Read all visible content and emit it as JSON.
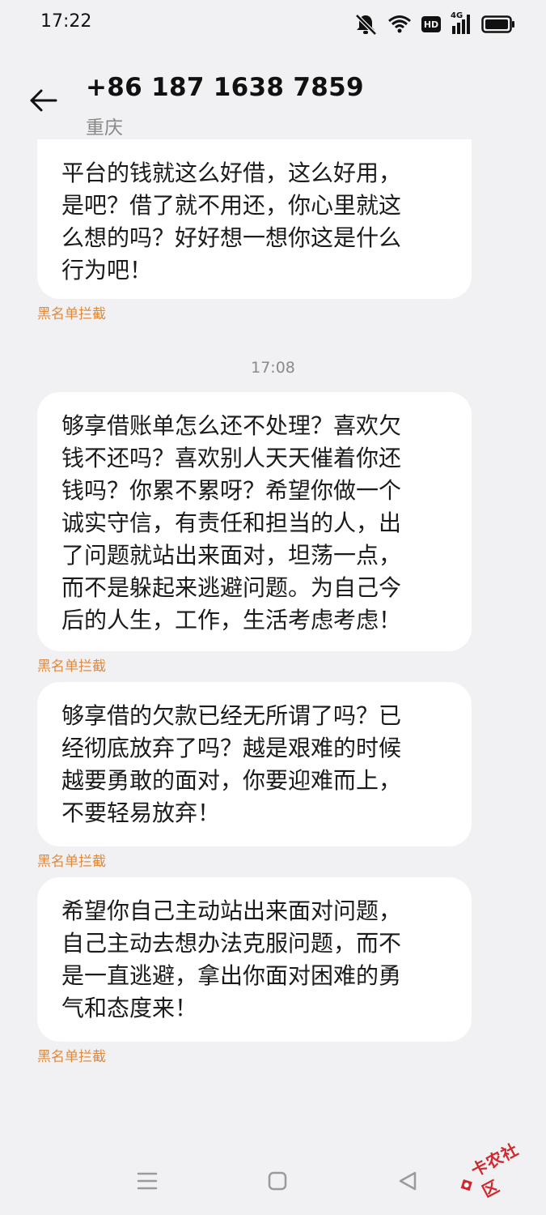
{
  "status_bar": {
    "time": "17:22",
    "icons": [
      "mute-icon",
      "wifi-icon",
      "hd-icon",
      "signal-4g-icon",
      "battery-icon"
    ],
    "hd_label": "HD",
    "network_label": "4G"
  },
  "header": {
    "back_icon": "arrow-left-icon",
    "number": "+86 187 1638 7859",
    "location": "重庆"
  },
  "messages": [
    {
      "text": "平台的钱就这么好借，这么好用，\n是吧？借了就不用还，你心里就这\n么想的吗？好好想一想你这是什么\n行为吧！",
      "tag": "黑名单拦截"
    },
    {
      "text": "够享借账单怎么还不处理？喜欢欠\n钱不还吗？喜欢别人天天催着你还\n钱吗？你累不累呀？希望你做一个\n诚实守信，有责任和担当的人，出\n了问题就站出来面对，坦荡一点，\n而不是躲起来逃避问题。为自己今\n后的人生，工作，生活考虑考虑！",
      "tag": "黑名单拦截"
    },
    {
      "text": "够享借的欠款已经无所谓了吗？已\n经彻底放弃了吗？越是艰难的时候\n越要勇敢的面对，你要迎难而上，\n不要轻易放弃！",
      "tag": "黑名单拦截"
    },
    {
      "text": "希望你自己主动站出来面对问题，\n自己主动去想办法克服问题，而不\n是一直逃避，拿出你面对困难的勇\n气和态度来！",
      "tag": "黑名单拦截"
    }
  ],
  "timestamp": "17:08",
  "nav_bar": {
    "icons": [
      "menu-icon",
      "home-icon",
      "back-triangle-icon"
    ]
  },
  "watermark": {
    "text": "卡农社区",
    "color": "#d0282e"
  },
  "colors": {
    "background": "#f1f1f3",
    "bubble": "#ffffff",
    "blocked_tag": "#e08a3c"
  }
}
